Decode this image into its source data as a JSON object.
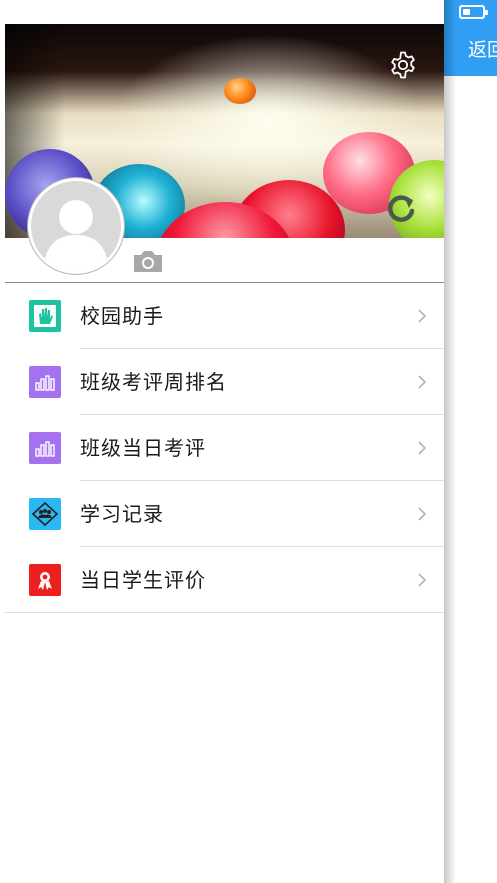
{
  "drawer": {
    "menu": [
      {
        "label": "校园助手",
        "icon": "palm-hand-icon",
        "color": "#1dc4a0"
      },
      {
        "label": "班级考评周排名",
        "icon": "bar-chart-icon",
        "color": "#a472f0"
      },
      {
        "label": "班级当日考评",
        "icon": "bar-chart-icon",
        "color": "#a472f0"
      },
      {
        "label": "学习记录",
        "icon": "study-group-icon",
        "color": "#29b9f2"
      },
      {
        "label": "当日学生评价",
        "icon": "award-ribbon-icon",
        "color": "#ee1f1f"
      }
    ]
  },
  "main": {
    "back_label": "返回",
    "navbar_color": "#2f9ef3"
  }
}
